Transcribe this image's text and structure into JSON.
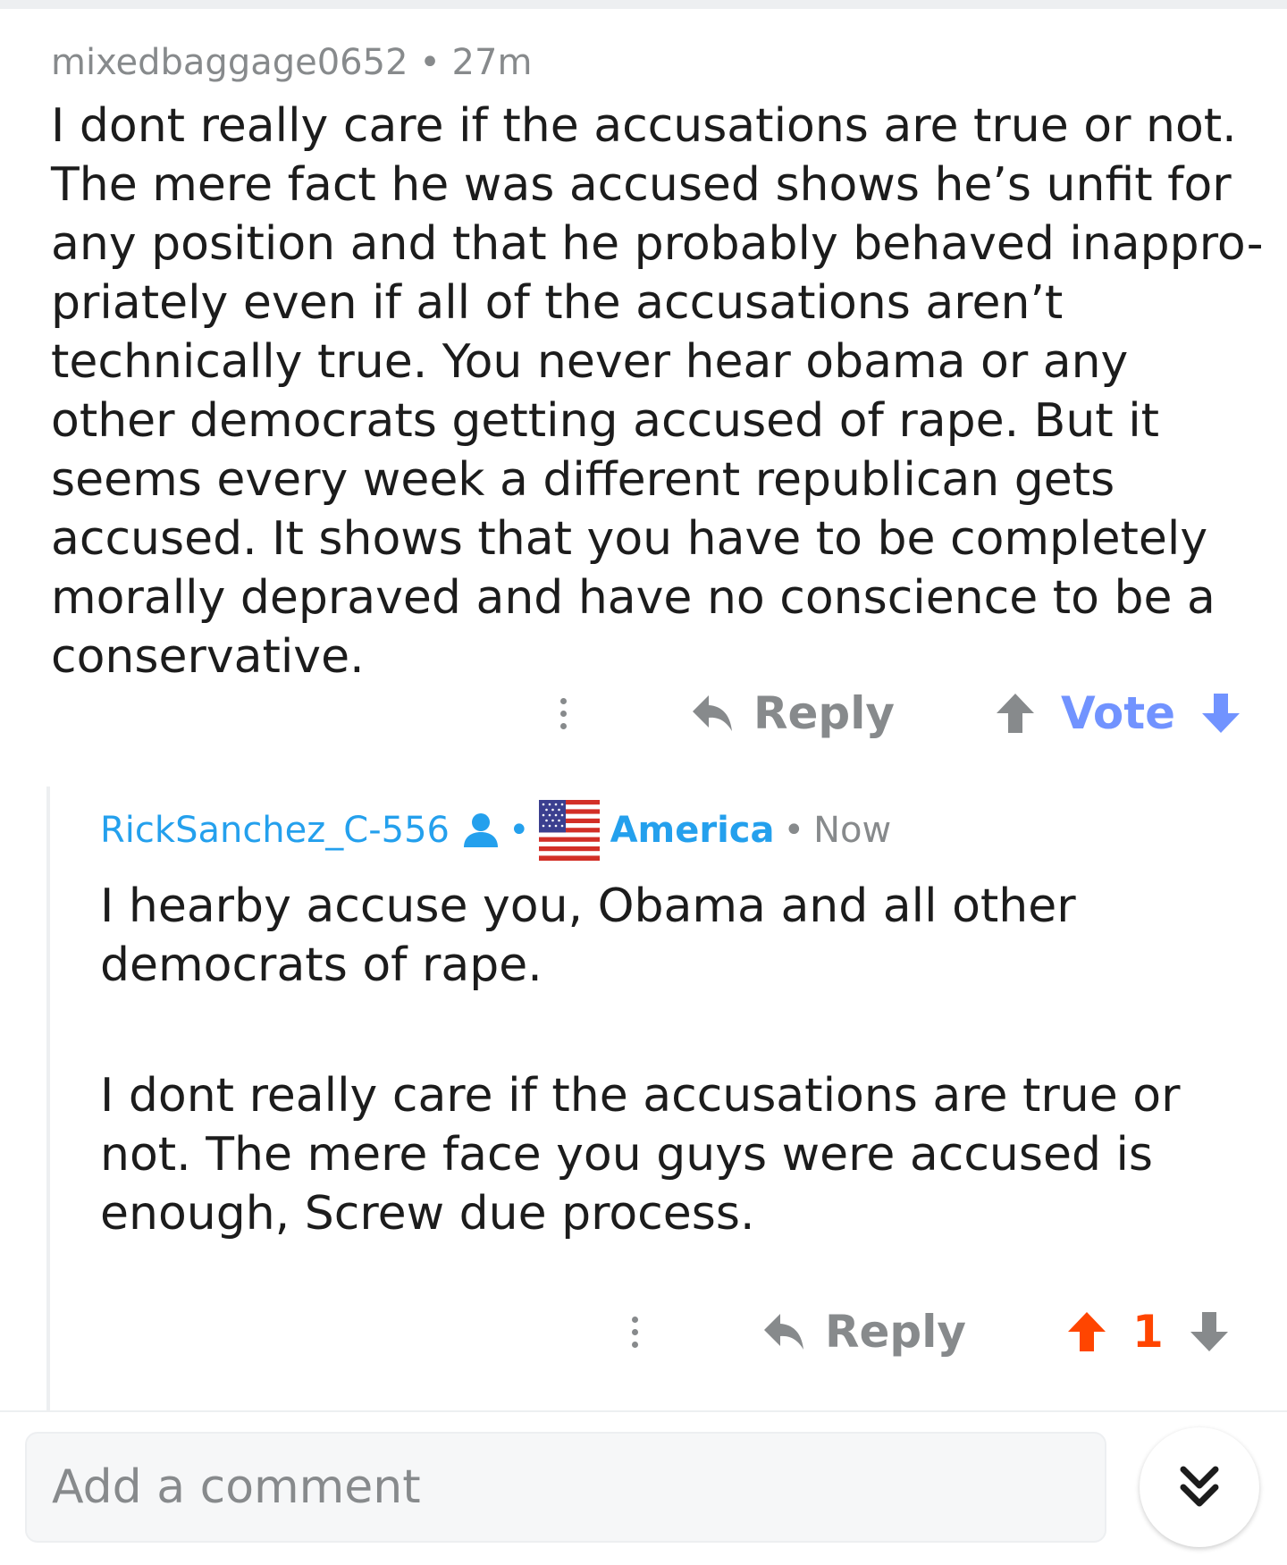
{
  "parent_comment": {
    "author": "mixedbaggage0652",
    "separator": "•",
    "age": "27m",
    "body": "I dont really care if the accusations are true or not. The mere fact he was accused shows he’s unfit for any position and that he probably behaved inappro-priately even if all of the accusations aren’t technically true. You never hear obama or any other democrats getting accused of rape. But it seems every week a different republican gets accused. It shows that you have to be completely morally depraved and have no conscience to be a conservative.",
    "reply_label": "Reply",
    "vote_label": "Vote"
  },
  "reply_comment": {
    "author": "RickSanchez_C-556",
    "separator": "•",
    "flair": "America",
    "age": "Now",
    "paragraphs": [
      "I hearby accuse you, Obama and all other democrats of rape.",
      "I dont really care if the accusations are true or not. The mere face you guys were accused is enough, Screw due process."
    ],
    "reply_label": "Reply",
    "score": "1"
  },
  "composer": {
    "placeholder": "Add a comment"
  },
  "icons": {
    "more": "kebab-vertical-icon",
    "reply": "reply-arrow-icon",
    "upvote": "upvote-arrow-icon",
    "downvote": "downvote-arrow-icon",
    "user": "user-icon",
    "flag": "us-flag-icon",
    "jump": "double-chevron-down-icon"
  },
  "colors": {
    "username_blue": "#24a0ed",
    "vote_blue": "#7193ff",
    "upvote_orange": "#ff4500",
    "meta_gray": "#878a8c"
  }
}
